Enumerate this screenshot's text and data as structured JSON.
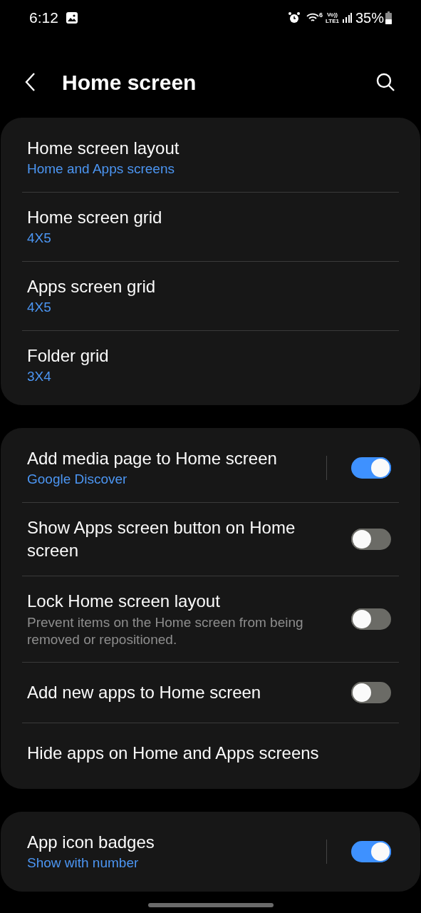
{
  "status_bar": {
    "time": "6:12",
    "wifi_badge": "6",
    "volte_top": "Vo))",
    "volte_bottom": "LTE1",
    "battery": "35%"
  },
  "header": {
    "title": "Home screen"
  },
  "groups": [
    {
      "items": [
        {
          "kind": "link",
          "title": "Home screen layout",
          "summary": "Home and Apps screens"
        },
        {
          "kind": "link",
          "title": "Home screen grid",
          "summary": "4X5"
        },
        {
          "kind": "link",
          "title": "Apps screen grid",
          "summary": "4X5"
        },
        {
          "kind": "link",
          "title": "Folder grid",
          "summary": "3X4"
        }
      ]
    },
    {
      "items": [
        {
          "kind": "switch_split",
          "title": "Add media page to Home screen",
          "summary": "Google Discover",
          "on": true
        },
        {
          "kind": "switch",
          "title": "Show Apps screen button on Home screen",
          "on": false
        },
        {
          "kind": "switch",
          "title": "Lock Home screen layout",
          "description": "Prevent items on the Home screen from being removed or repositioned.",
          "on": false
        },
        {
          "kind": "switch",
          "title": "Add new apps to Home screen",
          "on": false
        },
        {
          "kind": "link",
          "title": "Hide apps on Home and Apps screens"
        }
      ]
    },
    {
      "items": [
        {
          "kind": "switch_split",
          "title": "App icon badges",
          "summary": "Show with number",
          "on": true
        }
      ]
    }
  ]
}
